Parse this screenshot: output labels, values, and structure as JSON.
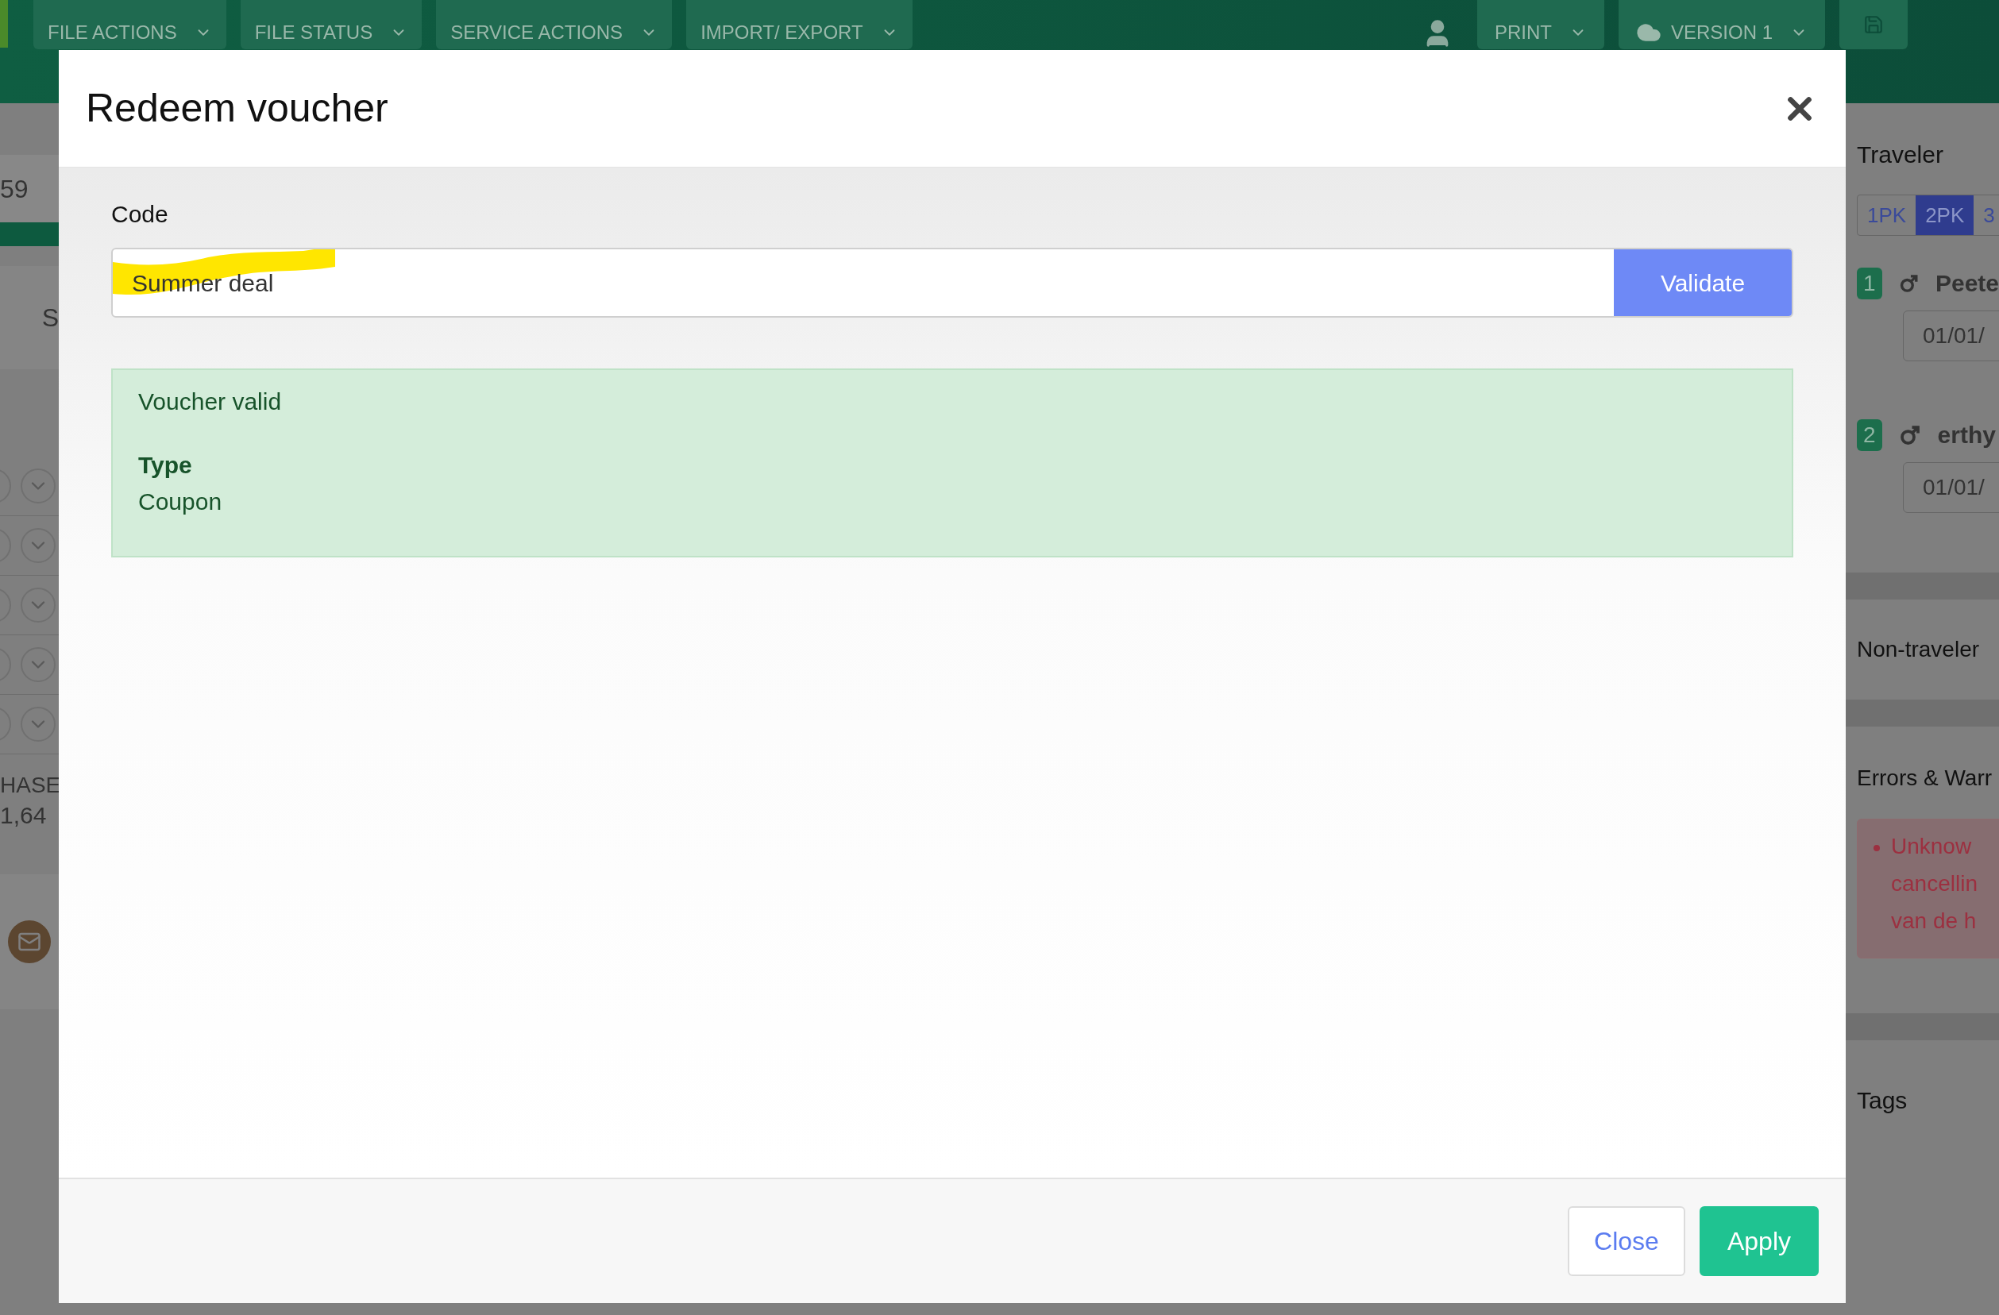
{
  "toolbar": {
    "buttons": [
      {
        "label": "FILE ACTIONS"
      },
      {
        "label": "FILE STATUS"
      },
      {
        "label": "SERVICE ACTIONS"
      },
      {
        "label": "IMPORT/ EXPORT"
      }
    ],
    "print": "PRINT",
    "version": "VERSION 1"
  },
  "left_panel": {
    "number": "59",
    "letter": "S",
    "purchase_label": "HASE",
    "purchase_value": "1,64"
  },
  "modal": {
    "title": "Redeem voucher",
    "code_label": "Code",
    "code_value": "Summer deal",
    "validate": "Validate",
    "alert": {
      "status": "Voucher valid",
      "field_label": "Type",
      "field_value": "Coupon"
    },
    "buttons": [
      {
        "label": "Close",
        "kind": "secondary"
      },
      {
        "label": "Apply",
        "kind": "primary"
      }
    ]
  },
  "right_panel": {
    "traveler_title": "Traveler",
    "tabs": [
      {
        "label": "1PK",
        "selected": false
      },
      {
        "label": "2PK",
        "selected": true
      },
      {
        "label": "3",
        "selected": false
      }
    ],
    "travelers": [
      {
        "number": "1",
        "name": "Peete",
        "date": "01/01/"
      },
      {
        "number": "2",
        "name": "erthy",
        "date": "01/01/"
      }
    ],
    "non_traveler_title": "Non-traveler",
    "errors_title": "Errors & Warr",
    "error_lines": [
      "Unknow",
      "cancellin",
      "van de h"
    ],
    "tags_title": "Tags"
  }
}
